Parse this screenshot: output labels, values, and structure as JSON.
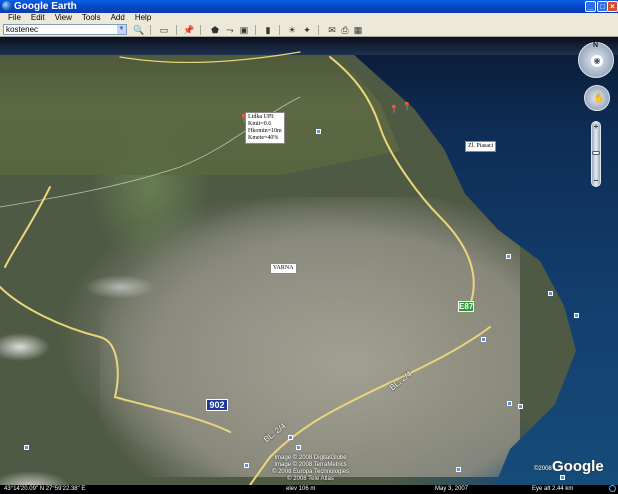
{
  "window": {
    "title": "Google Earth",
    "controls": {
      "minimize": "_",
      "maximize": "□",
      "close": "×"
    }
  },
  "menu": [
    "File",
    "Edit",
    "View",
    "Tools",
    "Add",
    "Help"
  ],
  "toolbar": {
    "search_value": "kostenec",
    "icons": [
      "search-go-icon",
      "sidebar-toggle-icon",
      "placemark-icon",
      "polygon-icon",
      "path-icon",
      "image-overlay-icon",
      "ruler-icon",
      "sun-icon",
      "sky-icon",
      "email-icon",
      "print-icon",
      "maps-icon"
    ]
  },
  "map": {
    "placemark_info": [
      "Lidka UPI:",
      "Kmit=0.6",
      "Hkomin=10m",
      "Kmete=40%"
    ],
    "labels": {
      "zl_piasaci": "Zl. Piasaci",
      "varna": "VARNA"
    },
    "shields": {
      "route_902": "902",
      "route_e87": "E87"
    },
    "road_labels": [
      "BL. 2/4",
      "BL. 2/4"
    ],
    "copyright": [
      "Image © 2008 DigitalGlobe",
      "Image © 2008 TerraMetrics",
      "© 2008 Europa Technologies",
      "© 2008 Tele Atlas"
    ],
    "logo": "Google",
    "logo_prefix": "©2008"
  },
  "navigation": {
    "look_north_label": "N",
    "zoom_plus": "+",
    "zoom_minus": "−",
    "zoom_level_fraction": 0.45
  },
  "status": {
    "coordinates": "43°14'20.09\" N    27°59'22.38\" E",
    "elevation": "elev  106 m",
    "date": "May 3, 2007",
    "eye_alt": "Eye alt    2.44 km"
  }
}
